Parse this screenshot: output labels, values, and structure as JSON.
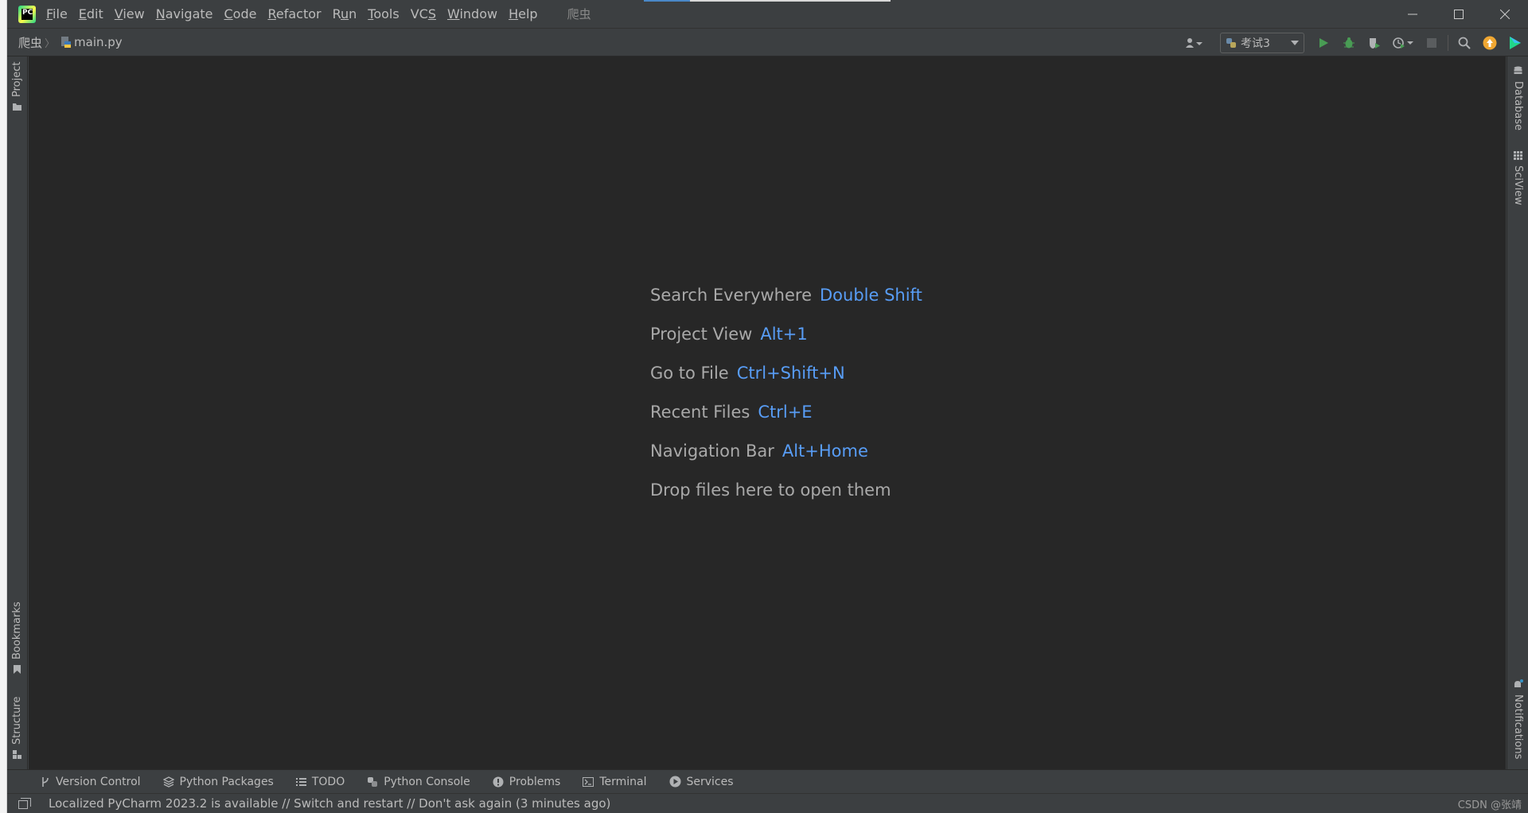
{
  "menu": {
    "items": [
      {
        "label": "File",
        "mnemonic": "F",
        "rest": "ile"
      },
      {
        "label": "Edit",
        "mnemonic": "E",
        "rest": "dit"
      },
      {
        "label": "View",
        "mnemonic": "V",
        "rest": "iew"
      },
      {
        "label": "Navigate",
        "mnemonic": "N",
        "rest": "avigate"
      },
      {
        "label": "Code",
        "mnemonic": "C",
        "rest": "ode"
      },
      {
        "label": "Refactor",
        "mnemonic": "R",
        "rest": "efactor"
      },
      {
        "label": "Run",
        "mnemonic": "R",
        "rest": "un",
        "pre": "",
        "underline_index": 1
      },
      {
        "label": "Tools",
        "mnemonic": "T",
        "rest": "ools"
      },
      {
        "label": "VCS",
        "mnemonic": "S",
        "rest": "",
        "pre": "VC"
      },
      {
        "label": "Window",
        "mnemonic": "W",
        "rest": "indow"
      },
      {
        "label": "Help",
        "mnemonic": "H",
        "rest": "elp"
      }
    ],
    "project_title": "爬虫"
  },
  "breadcrumb": {
    "project": "爬虫",
    "file": "main.py"
  },
  "toolbar": {
    "run_config": "考试3",
    "icons": [
      "user-icon",
      "run-icon",
      "debug-icon",
      "coverage-icon",
      "profile-icon",
      "stop-icon",
      "search-icon",
      "update-icon",
      "jetbrains-icon"
    ]
  },
  "side_left": {
    "project": "Project",
    "bookmarks": "Bookmarks",
    "structure": "Structure"
  },
  "side_right": {
    "database": "Database",
    "sciview": "SciView",
    "notifications": "Notifications"
  },
  "hints": [
    {
      "label": "Search Everywhere",
      "key": "Double Shift"
    },
    {
      "label": "Project View",
      "key": "Alt+1"
    },
    {
      "label": "Go to File",
      "key": "Ctrl+Shift+N"
    },
    {
      "label": "Recent Files",
      "key": "Ctrl+E"
    },
    {
      "label": "Navigation Bar",
      "key": "Alt+Home"
    },
    {
      "label": "Drop files here to open them",
      "key": ""
    }
  ],
  "bottom_tools": {
    "version_control": "Version Control",
    "python_packages": "Python Packages",
    "todo": "TODO",
    "python_console": "Python Console",
    "problems": "Problems",
    "terminal": "Terminal",
    "services": "Services"
  },
  "status": {
    "message": "Localized PyCharm 2023.2 is available // Switch and restart // Don't ask again (3 minutes ago)",
    "right": "CSDN @张靖"
  },
  "colors": {
    "accent": "#589df6",
    "editor_bg": "#272727",
    "chrome_bg": "#3c3f41",
    "run_green": "#499c54"
  }
}
